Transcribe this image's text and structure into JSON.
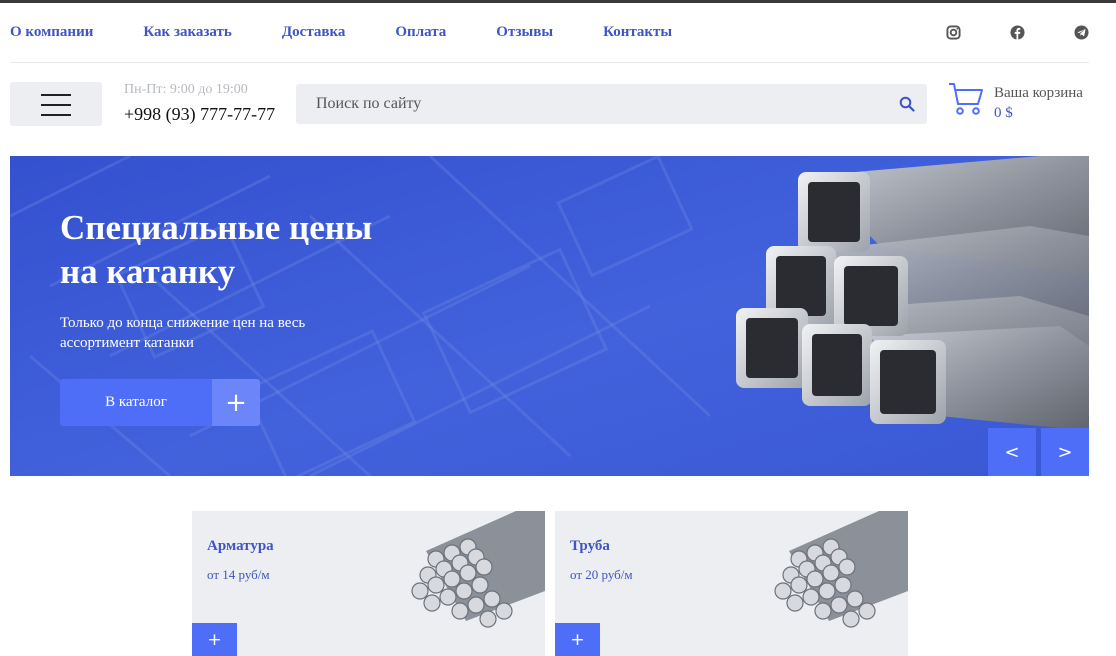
{
  "nav": {
    "items": [
      "О компании",
      "Как заказать",
      "Доставка",
      "Оплата",
      "Отзывы",
      "Контакты"
    ]
  },
  "social": [
    "instagram-icon",
    "facebook-icon",
    "telegram-icon"
  ],
  "header": {
    "hours": "Пн-Пт: 9:00 до 19:00",
    "phone": "+998 (93) 777-77-77",
    "search_placeholder": "Поиск по сайту",
    "cart_label": "Ваша корзина",
    "cart_total": "0 $"
  },
  "hero": {
    "title_line1": "Специальные цены",
    "title_line2": "на катанку",
    "subtitle": "Только до конца снижение цен на весь ассортимент катанки",
    "button_label": "В каталог",
    "plus": "+",
    "prev": "<",
    "next": ">"
  },
  "cards": [
    {
      "title": "Арматура",
      "price": "от 14 руб/м",
      "plus": "+"
    },
    {
      "title": "Труба",
      "price": "от 20 руб/м",
      "plus": "+"
    }
  ],
  "colors": {
    "accent": "#3f55c4",
    "button": "#4f6ef7",
    "hero_bg": "#3d5bd6",
    "panel": "#eceef2"
  }
}
